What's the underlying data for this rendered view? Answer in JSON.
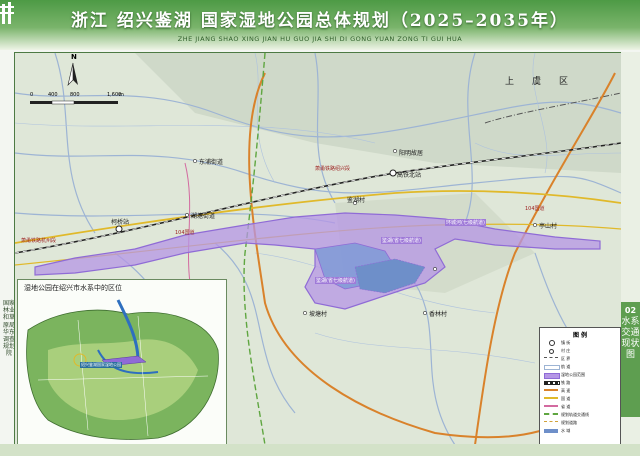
{
  "header": {
    "title": "浙江  绍兴鉴湖  国家湿地公园总体规划（2025–2035年）",
    "subtitle": "ZHE JIANG SHAO XING JIAN HU GUO JIA SHI DI GONG YUAN ZONG TI GUI HUA"
  },
  "left_strip": {
    "org": "国家林业和草原局华东调查规划院"
  },
  "right_strip": {
    "sheet_no": "02",
    "sheet_title": "水系交通现状图"
  },
  "map": {
    "north": "N",
    "scale": {
      "ticks": [
        "0",
        "400",
        "800",
        "1,600"
      ],
      "unit": "m"
    },
    "district_label": "上虞区",
    "places": [
      {
        "name": "高铁绍兴北站",
        "name_short": "高铁北站"
      },
      {
        "name": "阳明故居"
      },
      {
        "name": "柯桥站"
      },
      {
        "name": "亭山村"
      },
      {
        "name": "鉴湖村"
      },
      {
        "name": "东浦街道"
      },
      {
        "name": "湖塘街道"
      },
      {
        "name": "坡塘村"
      },
      {
        "name": "香林村"
      }
    ],
    "roads": [
      "萧甬铁路绍兴段",
      "104国道",
      "萧甬铁路杭州段",
      "104国道"
    ],
    "lake_labels": [
      "鉴湖(省七级航道)",
      "鉴湖(省七级航道)",
      "环城河(七级航道)"
    ]
  },
  "inset": {
    "title": "湿地公园在绍兴市水系中的区位",
    "park_label": "绍兴鉴湖国家湿地公园"
  },
  "legend": {
    "title": "图 例",
    "items": [
      {
        "label": "镇 街",
        "color": "#333333"
      },
      {
        "label": "村 庄",
        "color": "#333333"
      },
      {
        "label": "区 界",
        "color": "#555555"
      },
      {
        "label": "航 道",
        "color": "#ffffff"
      },
      {
        "label": "湿地公园范围",
        "color": "#8f6bd6"
      },
      {
        "label": "铁 路",
        "color": "#222222"
      },
      {
        "label": "高 速",
        "color": "#d9822b"
      },
      {
        "label": "国 道",
        "color": "#e0b92a"
      },
      {
        "label": "省 道",
        "color": "#d36aa0"
      },
      {
        "label": "规划轨道交通线",
        "color": "#5fa640"
      },
      {
        "label": "规划道路",
        "color": "#d2a23a"
      },
      {
        "label": "水 域",
        "color": "#6e8fc9"
      }
    ]
  },
  "colors": {
    "header_green": "#4d9a45",
    "wetland_boundary": "#8f6bd6",
    "railway": "#222222",
    "highway": "#d9822b",
    "national_road": "#e0b92a"
  }
}
